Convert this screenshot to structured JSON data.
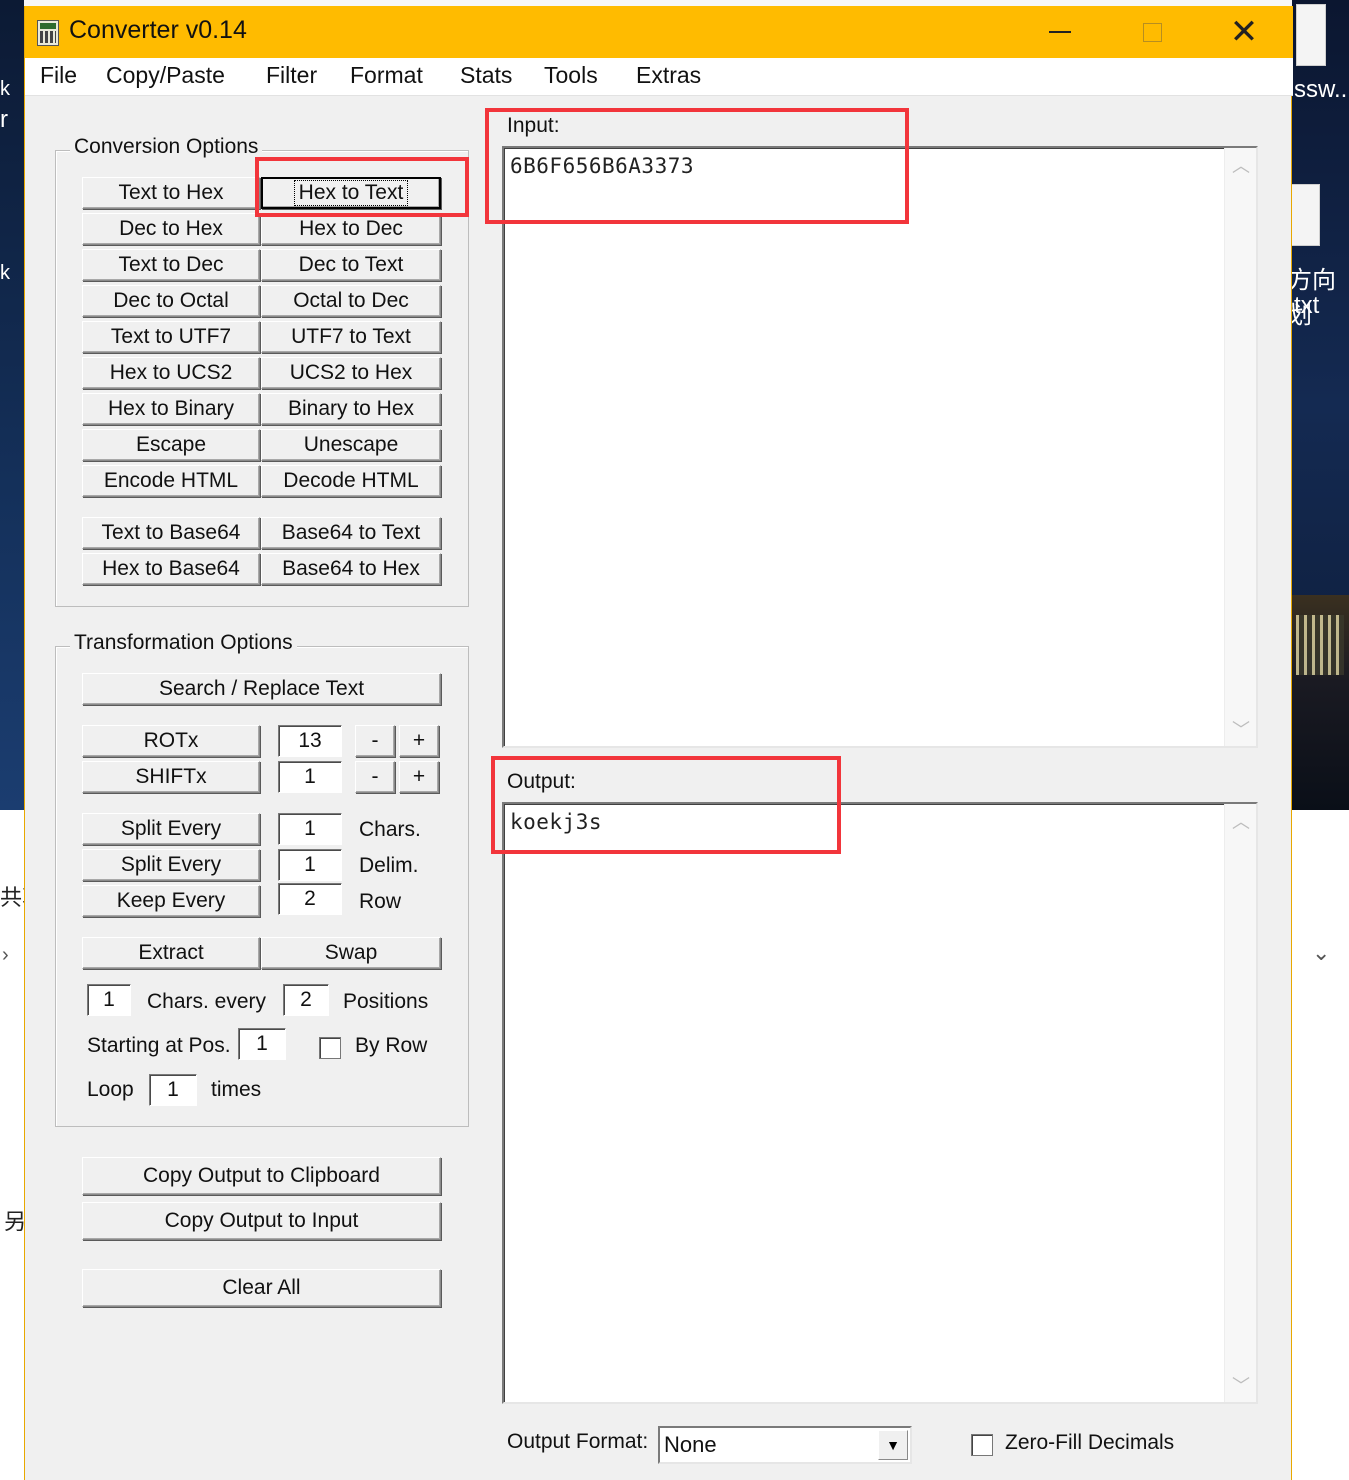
{
  "window": {
    "title": "Converter v0.14",
    "menu": [
      "File",
      "Copy/Paste",
      "Filter",
      "Format",
      "Stats",
      "Tools",
      "Extras"
    ]
  },
  "desktop": {
    "right_texts": [
      "ssw..",
      "方向划",
      "txt"
    ],
    "left_texts": [
      "k",
      "r",
      "k",
      "共享",
      "另"
    ]
  },
  "conversion": {
    "title": "Conversion Options",
    "buttons": [
      [
        "Text to Hex",
        "Hex to Text"
      ],
      [
        "Dec to Hex",
        "Hex to Dec"
      ],
      [
        "Text to Dec",
        "Dec to Text"
      ],
      [
        "Dec to Octal",
        "Octal to Dec"
      ],
      [
        "Text to UTF7",
        "UTF7 to Text"
      ],
      [
        "Hex to UCS2",
        "UCS2 to Hex"
      ],
      [
        "Hex to Binary",
        "Binary to Hex"
      ],
      [
        "Escape",
        "Unescape"
      ],
      [
        "Encode HTML",
        "Decode HTML"
      ],
      [
        "Text to Base64",
        "Base64 to Text"
      ],
      [
        "Hex to Base64",
        "Base64 to Hex"
      ]
    ]
  },
  "transformation": {
    "title": "Transformation Options",
    "search_replace": "Search / Replace Text",
    "rotx": {
      "label": "ROTx",
      "value": "13",
      "minus": "-",
      "plus": "+"
    },
    "shiftx": {
      "label": "SHIFTx",
      "value": "1",
      "minus": "-",
      "plus": "+"
    },
    "split_chars": {
      "label": "Split Every",
      "value": "1",
      "unit": "Chars."
    },
    "split_delim": {
      "label": "Split Every",
      "value": "1",
      "unit": "Delim."
    },
    "keep_every": {
      "label": "Keep Every",
      "value": "2",
      "unit": "Row"
    },
    "extract": "Extract",
    "swap": "Swap",
    "chars_value": "1",
    "chars_every_label": "Chars. every",
    "positions_value": "2",
    "positions_label": "Positions",
    "starting_label": "Starting at Pos.",
    "starting_value": "1",
    "by_row_label": "By Row",
    "loop_label": "Loop",
    "loop_value": "1",
    "times_label": "times"
  },
  "actions": {
    "copy_clipboard": "Copy Output to Clipboard",
    "copy_input": "Copy Output to Input",
    "clear_all": "Clear All"
  },
  "input": {
    "label": "Input:",
    "value": "6B6F656B6A3373"
  },
  "output": {
    "label": "Output:",
    "value": "koekj3s"
  },
  "output_format": {
    "label": "Output Format:",
    "selected": "None"
  },
  "zero_fill": {
    "label": "Zero-Fill Decimals",
    "checked": false
  },
  "colors": {
    "titlebar": "#ffbb00",
    "highlight": "#f2353b"
  }
}
